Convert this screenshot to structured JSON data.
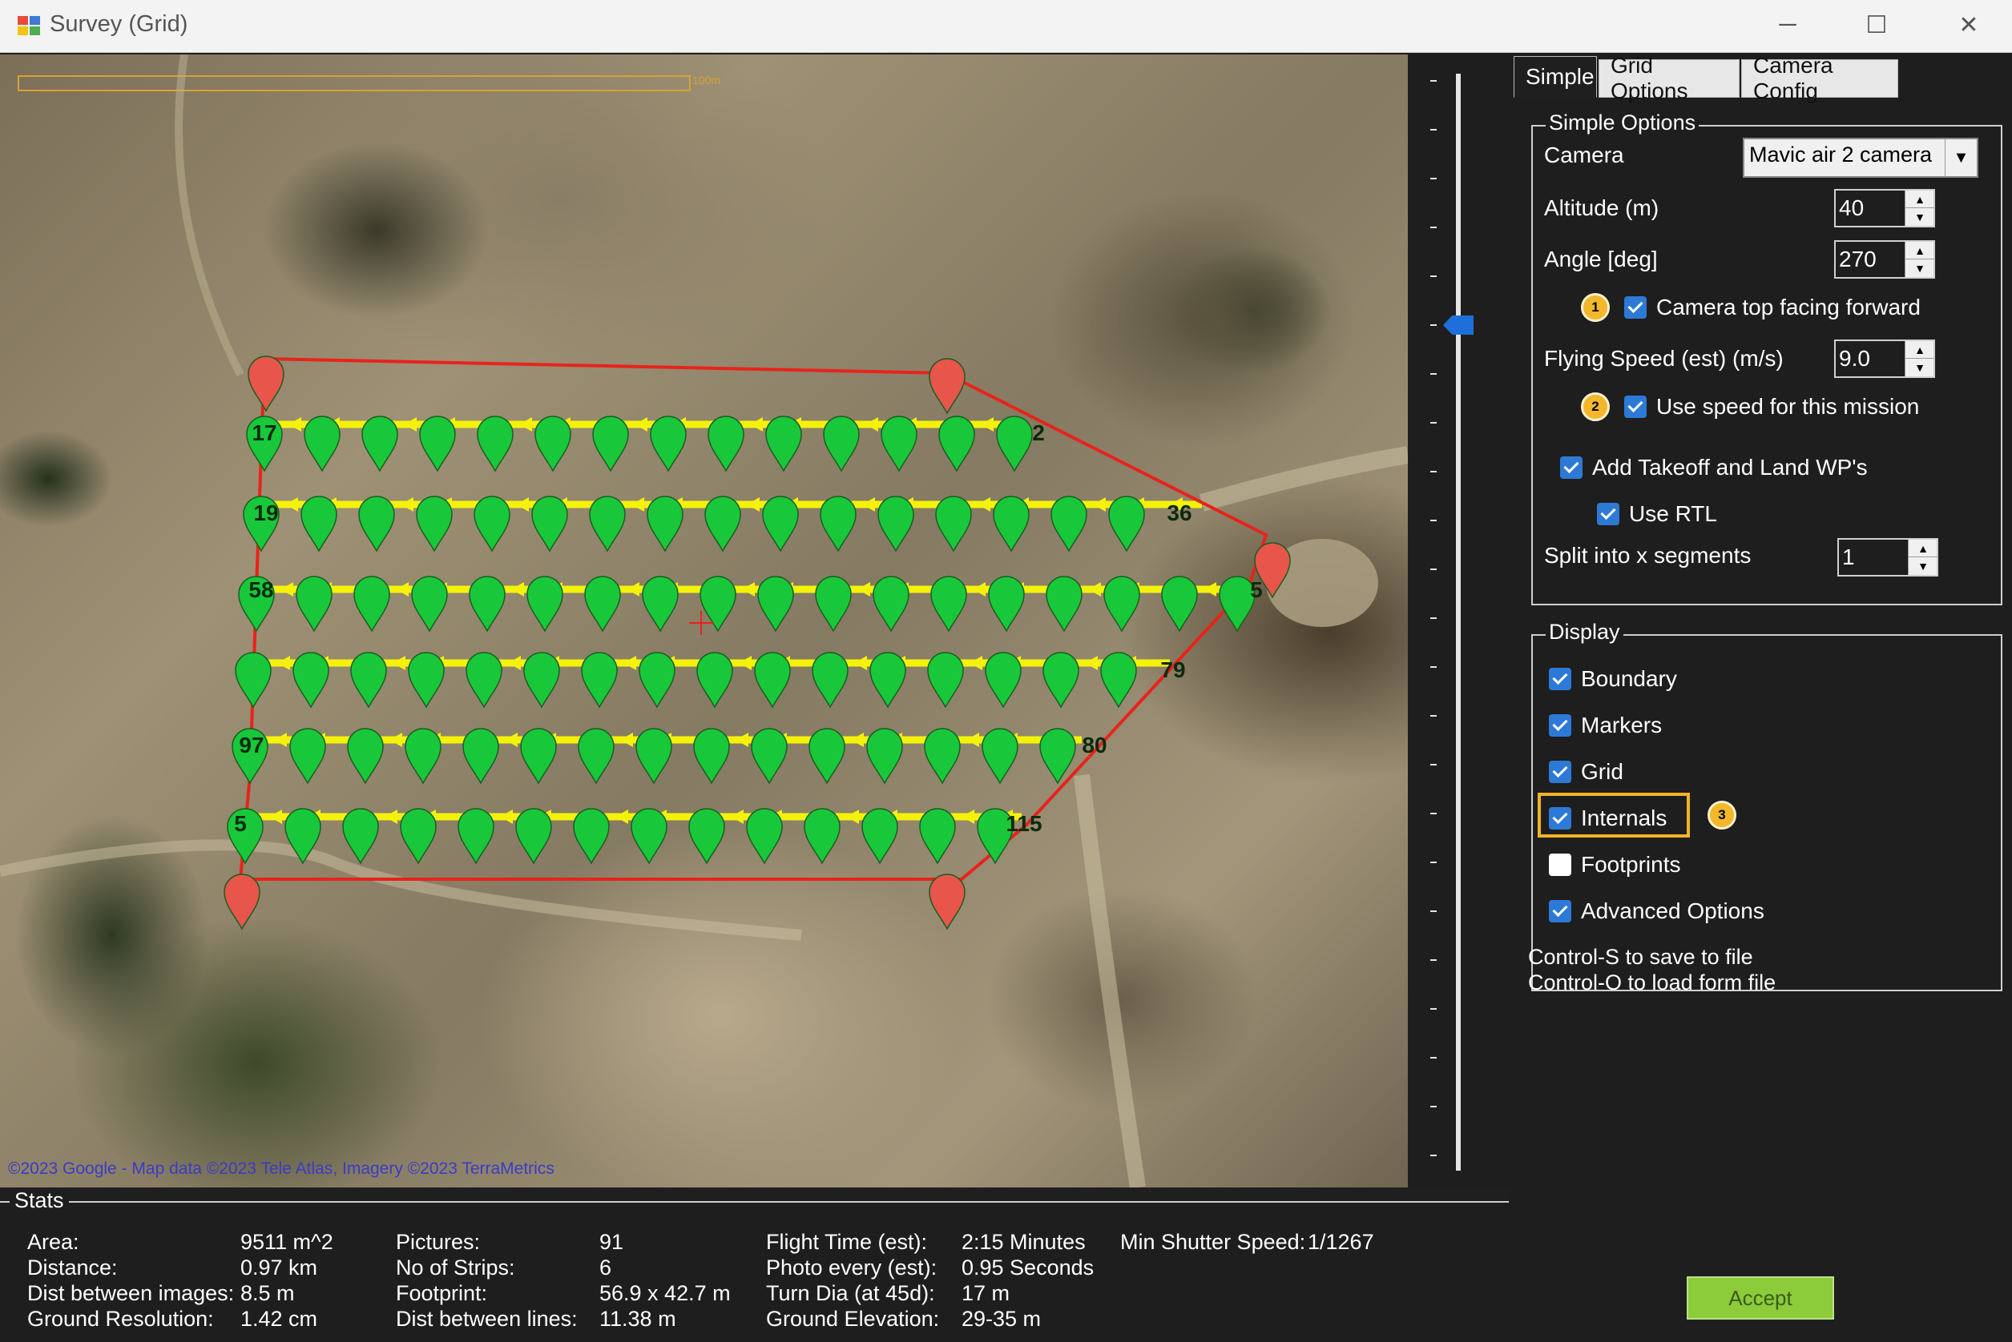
{
  "window": {
    "title": "Survey (Grid)",
    "minimize": "─",
    "maximize": "☐",
    "close": "✕"
  },
  "map": {
    "attribution": "©2023 Google - Map data ©2023 Tele Atlas, Imagery ©2023 TerraMetrics",
    "scale_label": "100m",
    "marker_labels": [
      "17",
      "2",
      "19",
      "36",
      "58",
      "5",
      "79",
      "97",
      "80",
      "115",
      "5"
    ]
  },
  "tabs": [
    {
      "label": "Simple",
      "active": true
    },
    {
      "label": "Grid Options",
      "active": false
    },
    {
      "label": "Camera Config",
      "active": false
    }
  ],
  "simple_options": {
    "legend": "Simple Options",
    "camera_label": "Camera",
    "camera_value": "Mavic air 2 camera",
    "altitude_label": "Altitude (m)",
    "altitude_value": "40",
    "angle_label": "Angle [deg]",
    "angle_value": "270",
    "camera_top_label": "Camera top facing forward",
    "camera_top_checked": true,
    "speed_label": "Flying Speed (est) (m/s)",
    "speed_value": "9.0",
    "use_speed_label": "Use speed for this mission",
    "use_speed_checked": true,
    "takeoff_label": "Add Takeoff and Land WP's",
    "takeoff_checked": true,
    "rtl_label": "Use RTL",
    "rtl_checked": true,
    "split_label": "Split into x segments",
    "split_value": "1"
  },
  "display": {
    "legend": "Display",
    "items": [
      {
        "label": "Boundary",
        "checked": true
      },
      {
        "label": "Markers",
        "checked": true
      },
      {
        "label": "Grid",
        "checked": true
      },
      {
        "label": "Internals",
        "checked": true
      },
      {
        "label": "Footprints",
        "checked": false
      },
      {
        "label": "Advanced Options",
        "checked": true
      }
    ]
  },
  "badges": [
    "1",
    "2",
    "3"
  ],
  "hints": [
    "Control-S to save to file",
    "Control-O to load form file"
  ],
  "accept_label": "Accept",
  "stats": {
    "legend": "Stats",
    "col1": [
      {
        "label": "Area:",
        "value": "9511 m^2"
      },
      {
        "label": "Distance:",
        "value": "0.97 km"
      },
      {
        "label": "Dist between images:",
        "value": "8.5 m"
      },
      {
        "label": "Ground Resolution:",
        "value": "1.42 cm"
      }
    ],
    "col2": [
      {
        "label": "Pictures:",
        "value": "91"
      },
      {
        "label": "No of Strips:",
        "value": "6"
      },
      {
        "label": "Footprint:",
        "value": "56.9 x 42.7 m"
      },
      {
        "label": "Dist between lines:",
        "value": "11.38 m"
      }
    ],
    "col3": [
      {
        "label": "Flight Time (est):",
        "value": "2:15 Minutes"
      },
      {
        "label": "Photo every (est):",
        "value": "0.95 Seconds"
      },
      {
        "label": "Turn Dia (at 45d):",
        "value": "17 m"
      },
      {
        "label": "Ground Elevation:",
        "value": "29-35 m"
      }
    ],
    "col4": [
      {
        "label": "Min Shutter Speed:",
        "value": "1/1267"
      }
    ]
  },
  "colors": {
    "boundary": "#e8231b",
    "grid_line": "#f5f20a",
    "marker_green": "#18c83a",
    "marker_red": "#e8554a",
    "checkbox": "#2d7ad6",
    "badge": "#f2b72b",
    "accept": "#8ccb3a"
  }
}
